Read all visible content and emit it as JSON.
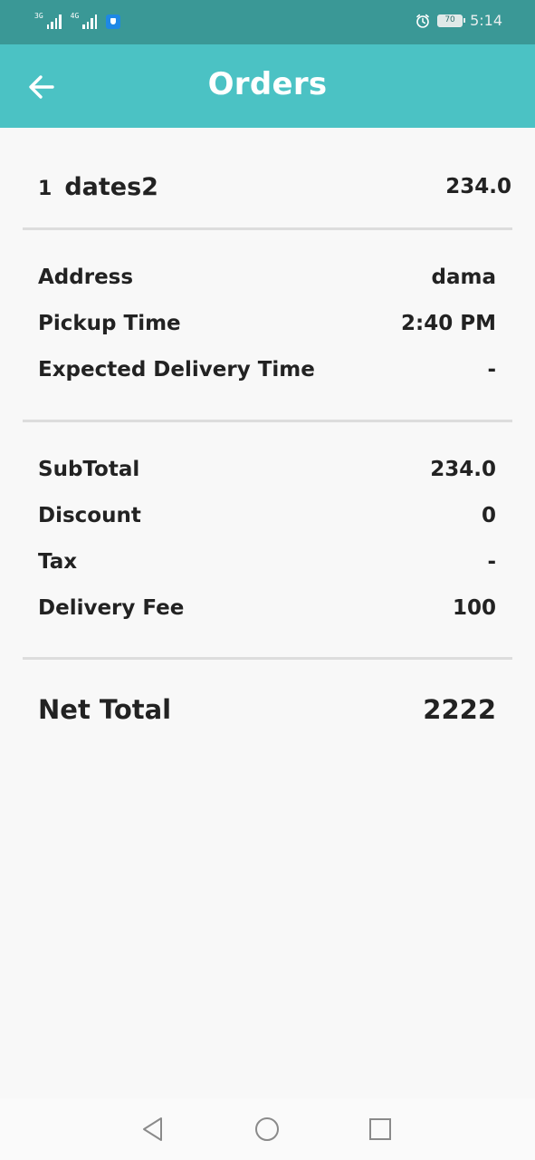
{
  "status_bar": {
    "network_1": "3G",
    "network_2": "4G",
    "battery": "70",
    "time": "5:14"
  },
  "header": {
    "title": "Orders",
    "back_icon": "arrow-left-icon"
  },
  "order_item": {
    "quantity": "1",
    "name": "dates2",
    "price": "234.0"
  },
  "details": {
    "address_label": "Address",
    "address_value": "dama",
    "pickup_label": "Pickup Time",
    "pickup_value": "2:40 PM",
    "expected_label": "Expected Delivery Time",
    "expected_value": "-"
  },
  "summary": {
    "subtotal_label": "SubTotal",
    "subtotal_value": "234.0",
    "discount_label": "Discount",
    "discount_value": "0",
    "tax_label": "Tax",
    "tax_value": "-",
    "delivery_fee_label": "Delivery Fee",
    "delivery_fee_value": "100"
  },
  "total": {
    "label": "Net Total",
    "value": "2222"
  },
  "nav_bar": {
    "back_icon": "triangle-back-icon",
    "home_icon": "circle-home-icon",
    "recents_icon": "square-recents-icon"
  },
  "colors": {
    "status_bar": "#3a9896",
    "app_bar": "#4bc2c4",
    "background": "#f8f8f8",
    "divider": "#dddddd"
  }
}
